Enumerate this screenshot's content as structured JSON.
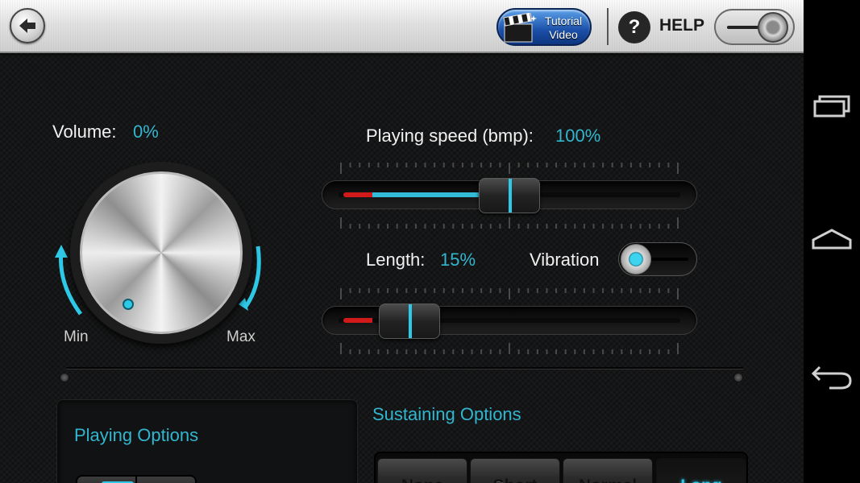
{
  "header": {
    "tutorial_line1": "Tutorial",
    "tutorial_line2": "Video",
    "help_icon": "?",
    "help_label": "HELP"
  },
  "volume": {
    "label": "Volume:",
    "value": "0%",
    "min_label": "Min",
    "max_label": "Max",
    "level": 0
  },
  "speed": {
    "label": "Playing speed (bmp):",
    "value": "100%",
    "slider_fraction": 0.5
  },
  "length": {
    "label": "Length:",
    "value": "15%",
    "slider_fraction": 0.15
  },
  "vibration": {
    "label": "Vibration",
    "on": true
  },
  "playing_options": {
    "title": "Playing Options"
  },
  "sustaining_options": {
    "title": "Sustaining Options",
    "options": [
      "None",
      "Short",
      "Normal",
      "Long"
    ],
    "selected": "Long"
  },
  "colors": {
    "accent": "#32b6cf",
    "red": "#d11b1b",
    "text": "#f1f1f1"
  },
  "icons": {
    "back": "back-arrow-icon",
    "tutorial": "clapperboard-icon",
    "help": "question-mark-icon",
    "nav_recents": "recents-icon",
    "nav_home": "home-icon",
    "nav_back": "back-icon"
  }
}
